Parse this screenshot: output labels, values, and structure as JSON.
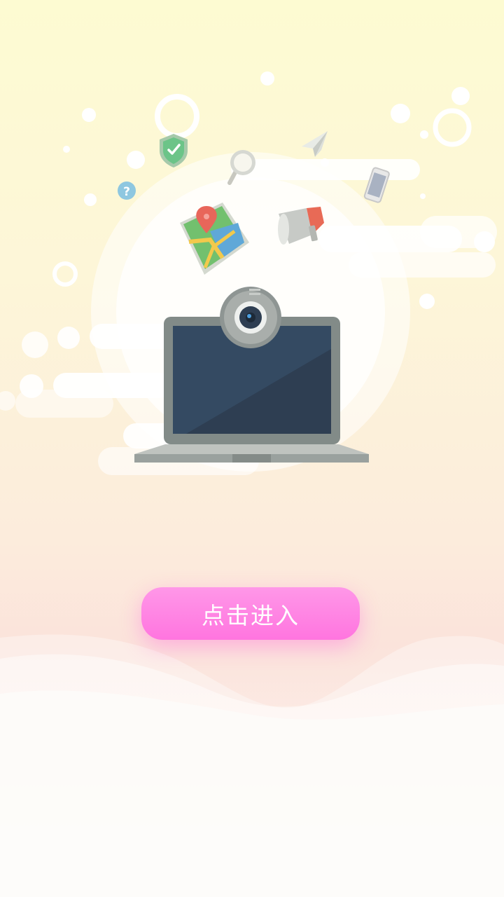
{
  "splash": {
    "enter_button_label": "点击进入"
  },
  "help_bubble": {
    "glyph": "?"
  },
  "icons": [
    "shield-check-icon",
    "magnifier-icon",
    "paper-plane-icon",
    "smartphone-icon",
    "map-pin-icon",
    "megaphone-icon",
    "webcam-icon",
    "laptop-icon"
  ],
  "colors": {
    "button_top": "#ff97e8",
    "button_bottom": "#ff75df",
    "background_top": "#fdfbd2",
    "background_bottom": "#fdfbf9"
  }
}
